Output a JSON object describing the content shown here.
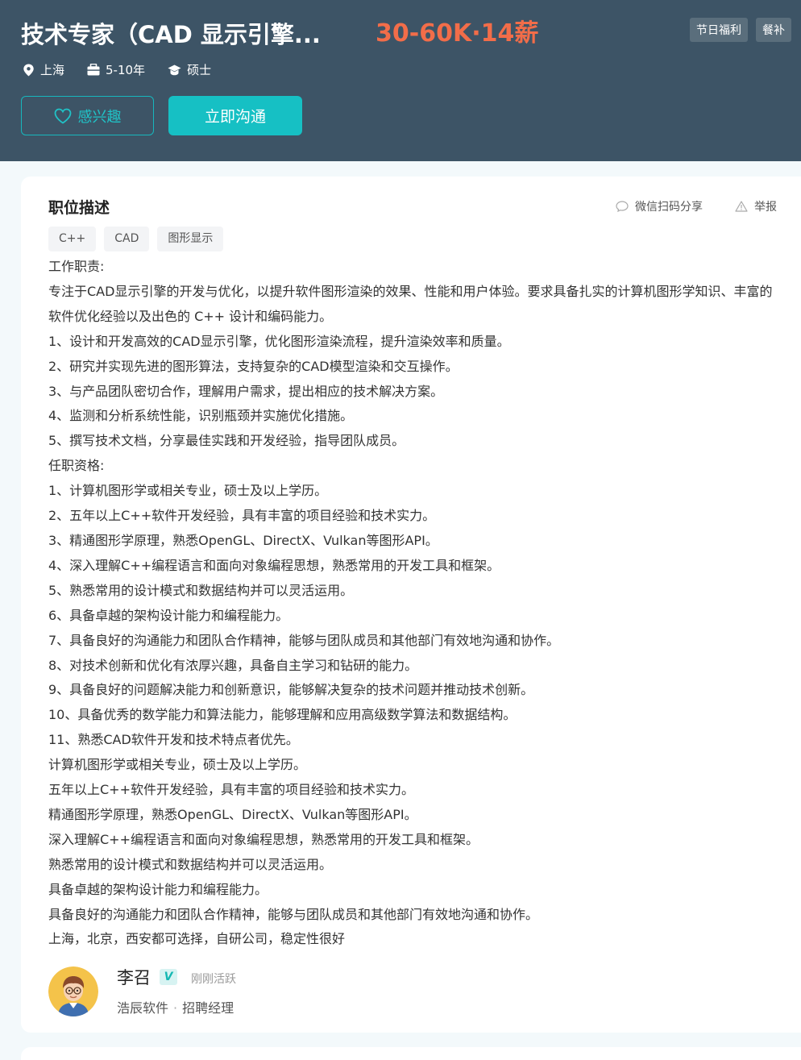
{
  "job": {
    "title": "技术专家（CAD 显示引擎...",
    "salary": "30-60K·14薪",
    "benefits": [
      "节日福利",
      "餐补"
    ],
    "location": "上海",
    "experience": "5-10年",
    "degree": "硕士"
  },
  "actions": {
    "interest_label": "感兴趣",
    "chat_label": "立即沟通",
    "share_label": "微信扫码分享",
    "report_label": "举报"
  },
  "description": {
    "section_title": "职位描述",
    "tags": [
      "C++",
      "CAD",
      "图形显示"
    ],
    "lines": [
      "工作职责:",
      "专注于CAD显示引擎的开发与优化，以提升软件图形渲染的效果、性能和用户体验。要求具备扎实的计算机图形学知识、丰富的软件优化经验以及出色的 C++ 设计和编码能力。",
      "1、设计和开发高效的CAD显示引擎，优化图形渲染流程，提升渲染效率和质量。",
      "2、研究并实现先进的图形算法，支持复杂的CAD模型渲染和交互操作。",
      "3、与产品团队密切合作，理解用户需求，提出相应的技术解决方案。",
      "4、监测和分析系统性能，识别瓶颈并实施优化措施。",
      "5、撰写技术文档，分享最佳实践和开发经验，指导团队成员。",
      "任职资格:",
      "1、计算机图形学或相关专业，硕士及以上学历。",
      "2、五年以上C++软件开发经验，具有丰富的项目经验和技术实力。",
      "3、精通图形学原理，熟悉OpenGL、DirectX、Vulkan等图形API。",
      "4、深入理解C++编程语言和面向对象编程思想，熟悉常用的开发工具和框架。",
      "5、熟悉常用的设计模式和数据结构并可以灵活运用。",
      "6、具备卓越的架构设计能力和编程能力。",
      "7、具备良好的沟通能力和团队合作精神，能够与团队成员和其他部门有效地沟通和协作。",
      "8、对技术创新和优化有浓厚兴趣，具备自主学习和钻研的能力。",
      "9、具备良好的问题解决能力和创新意识，能够解决复杂的技术问题并推动技术创新。",
      "10、具备优秀的数学能力和算法能力，能够理解和应用高级数学算法和数据结构。",
      "11、熟悉CAD软件开发和技术特点者优先。",
      "计算机图形学或相关专业，硕士及以上学历。",
      "五年以上C++软件开发经验，具有丰富的项目经验和技术实力。",
      "精通图形学原理，熟悉OpenGL、DirectX、Vulkan等图形API。",
      "深入理解C++编程语言和面向对象编程思想，熟悉常用的开发工具和框架。",
      "熟悉常用的设计模式和数据结构并可以灵活运用。",
      "具备卓越的架构设计能力和编程能力。",
      "具备良好的沟通能力和团队合作精神，能够与团队成员和其他部门有效地沟通和协作。",
      "上海，北京，西安都可选择，自研公司，稳定性很好"
    ]
  },
  "recruiter": {
    "name": "李召",
    "verified_badge": "V",
    "status": "刚刚活跃",
    "company": "浩辰软件",
    "separator": "·",
    "role": "招聘经理"
  },
  "colors": {
    "header_bg": "#3d5466",
    "salary": "#f26d49",
    "accent": "#16c0c4",
    "page_bg": "#f3f9fb"
  }
}
